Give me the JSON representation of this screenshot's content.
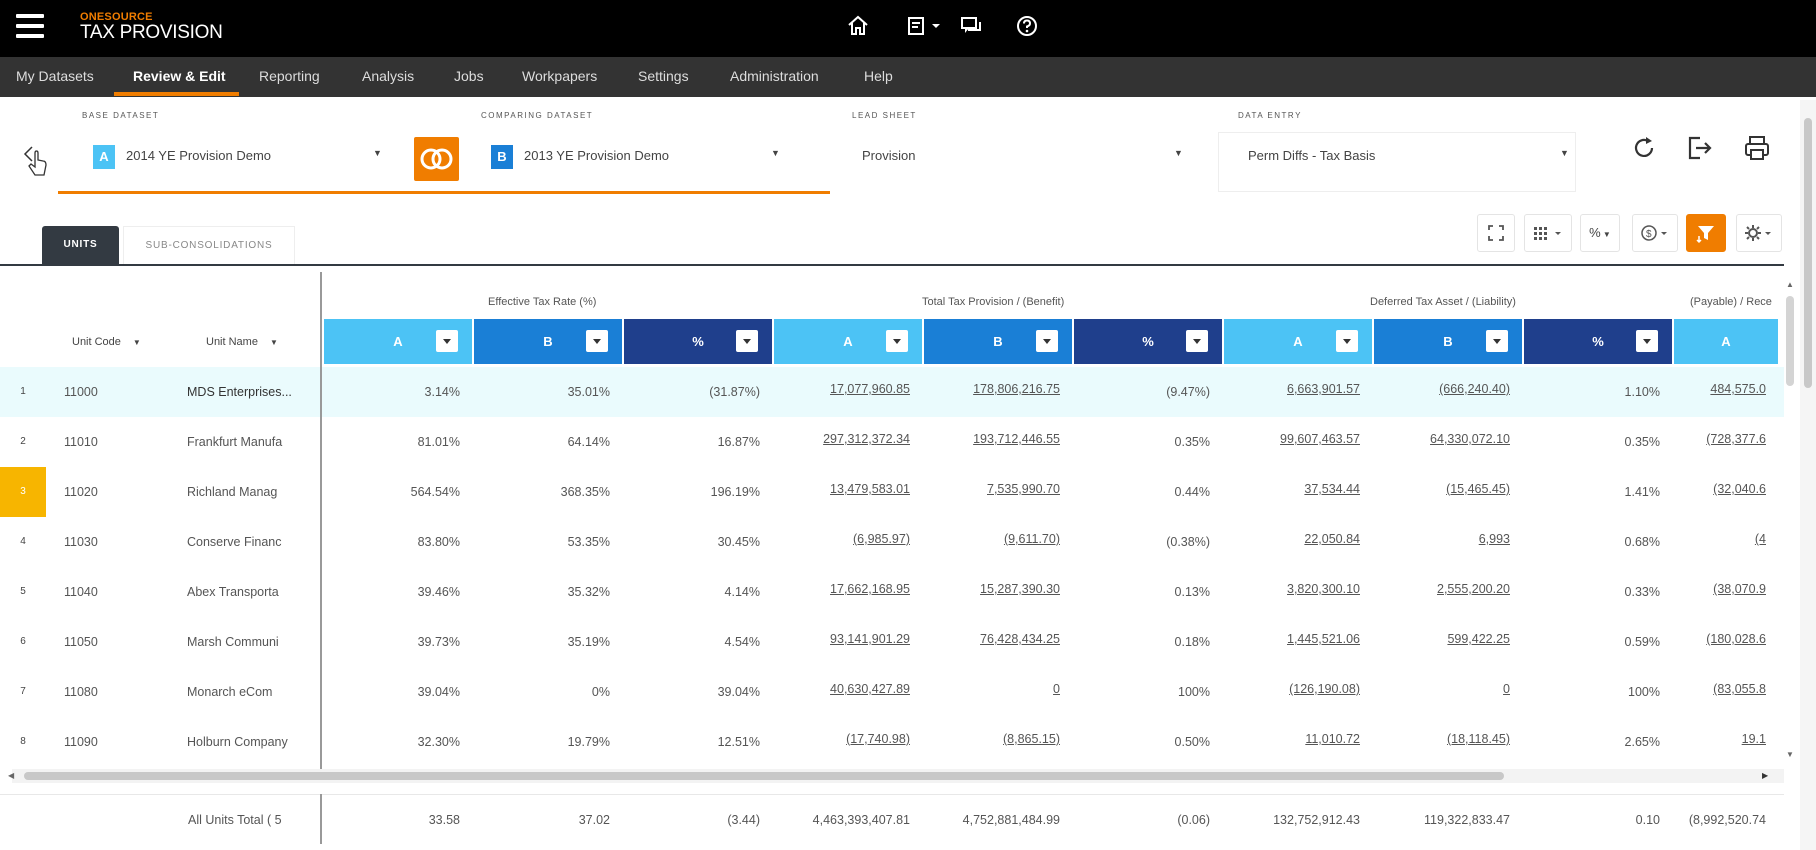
{
  "app": {
    "brand_top": "ONESOURCE",
    "brand_bottom": "TAX PROVISION"
  },
  "topbar": {
    "icons": [
      "home-icon",
      "report-dropdown-icon",
      "chat-icon",
      "help-icon"
    ]
  },
  "nav": {
    "items": [
      "My Datasets",
      "Review & Edit",
      "Reporting",
      "Analysis",
      "Jobs",
      "Workpapers",
      "Settings",
      "Administration",
      "Help"
    ],
    "active": "Review & Edit"
  },
  "datasets": {
    "base": {
      "label": "BASE DATASET",
      "badge": "A",
      "value": "2014 YE Provision Demo"
    },
    "comparing": {
      "label": "COMPARING DATASET",
      "badge": "B",
      "value": "2013 YE Provision Demo"
    },
    "lead_sheet": {
      "label": "LEAD SHEET",
      "value": "Provision"
    },
    "data_entry": {
      "label": "DATA ENTRY",
      "value": "Perm Diffs - Tax Basis"
    }
  },
  "tabs": [
    "UNITS",
    "SUB-CONSOLIDATIONS"
  ],
  "toolbar": {
    "percent": "%"
  },
  "grid": {
    "unit_code_header": "Unit Code",
    "unit_name_header": "Unit Name",
    "groups": [
      "Effective Tax Rate (%)",
      "Total Tax Provision / (Benefit)",
      "Deferred Tax Asset / (Liability)",
      "(Payable) / Rece"
    ],
    "col_headers": [
      "A",
      "B",
      "%",
      "A",
      "B",
      "%",
      "A",
      "B",
      "%",
      "A"
    ],
    "rows": [
      {
        "n": "1",
        "code": "11000",
        "name": "MDS Enterprises...",
        "v": [
          "3.14%",
          "35.01%",
          "(31.87%)",
          "17,077,960.85",
          "178,806,216.75",
          "(9.47%)",
          "6,663,901.57",
          "(666,240.40)",
          "1.10%",
          "484,575.0"
        ]
      },
      {
        "n": "2",
        "code": "11010",
        "name": "Frankfurt Manufa",
        "v": [
          "81.01%",
          "64.14%",
          "16.87%",
          "297,312,372.34",
          "193,712,446.55",
          "0.35%",
          "99,607,463.57",
          "64,330,072.10",
          "0.35%",
          "(728,377.6"
        ]
      },
      {
        "n": "3",
        "code": "11020",
        "name": "Richland Manag",
        "v": [
          "564.54%",
          "368.35%",
          "196.19%",
          "13,479,583.01",
          "7,535,990.70",
          "0.44%",
          "37,534.44",
          "(15,465.45)",
          "1.41%",
          "(32,040.6"
        ]
      },
      {
        "n": "4",
        "code": "11030",
        "name": "Conserve Financ",
        "v": [
          "83.80%",
          "53.35%",
          "30.45%",
          "(6,985.97)",
          "(9,611.70)",
          "(0.38%)",
          "22,050.84",
          "6,993",
          "0.68%",
          "(4"
        ]
      },
      {
        "n": "5",
        "code": "11040",
        "name": "Abex Transporta",
        "v": [
          "39.46%",
          "35.32%",
          "4.14%",
          "17,662,168.95",
          "15,287,390.30",
          "0.13%",
          "3,820,300.10",
          "2,555,200.20",
          "0.33%",
          "(38,070.9"
        ]
      },
      {
        "n": "6",
        "code": "11050",
        "name": "Marsh Communi",
        "v": [
          "39.73%",
          "35.19%",
          "4.54%",
          "93,141,901.29",
          "76,428,434.25",
          "0.18%",
          "1,445,521.06",
          "599,422.25",
          "0.59%",
          "(180,028.6"
        ]
      },
      {
        "n": "7",
        "code": "11080",
        "name": "Monarch eCom",
        "v": [
          "39.04%",
          "0%",
          "39.04%",
          "40,630,427.89",
          "0",
          "100%",
          "(126,190.08)",
          "0",
          "100%",
          "(83,055.8"
        ]
      },
      {
        "n": "8",
        "code": "11090",
        "name": "Holburn Company",
        "v": [
          "32.30%",
          "19.79%",
          "12.51%",
          "(17,740.98)",
          "(8,865.15)",
          "0.50%",
          "11,010.72",
          "(18,118.45)",
          "2.65%",
          "19.1"
        ]
      }
    ],
    "total": {
      "label": "All Units Total ( 5",
      "v": [
        "33.58",
        "37.02",
        "(3.44)",
        "4,463,393,407.81",
        "4,752,881,484.99",
        "(0.06)",
        "132,752,912.43",
        "119,322,833.47",
        "0.10",
        "(8,992,520.74"
      ]
    }
  },
  "colors": {
    "orange": "#f07d00",
    "colA": "#4cc3f5",
    "colB": "#1a7fd6",
    "colP": "#1f3f8c",
    "yellow": "#f7b500"
  }
}
